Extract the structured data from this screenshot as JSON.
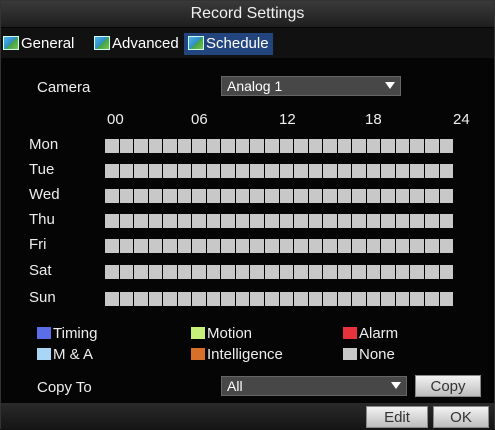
{
  "window": {
    "title": "Record Settings"
  },
  "tabs": [
    {
      "label": "General"
    },
    {
      "label": "Advanced"
    },
    {
      "label": "Schedule"
    }
  ],
  "camera": {
    "label": "Camera",
    "value": "Analog 1"
  },
  "hours": [
    "00",
    "06",
    "12",
    "18",
    "24"
  ],
  "days": [
    "Mon",
    "Tue",
    "Wed",
    "Thu",
    "Fri",
    "Sat",
    "Sun"
  ],
  "legend": [
    {
      "label": "Timing",
      "color": "#5b6ee8"
    },
    {
      "label": "Motion",
      "color": "#c6f07a"
    },
    {
      "label": "Alarm",
      "color": "#e8323c"
    },
    {
      "label": "M & A",
      "color": "#a9d6f5"
    },
    {
      "label": "Intelligence",
      "color": "#d9702a"
    },
    {
      "label": "None",
      "color": "#c8c8c8"
    }
  ],
  "copy_to": {
    "label": "Copy To",
    "value": "All",
    "button": "Copy"
  },
  "footer": {
    "edit": "Edit",
    "ok": "OK"
  }
}
